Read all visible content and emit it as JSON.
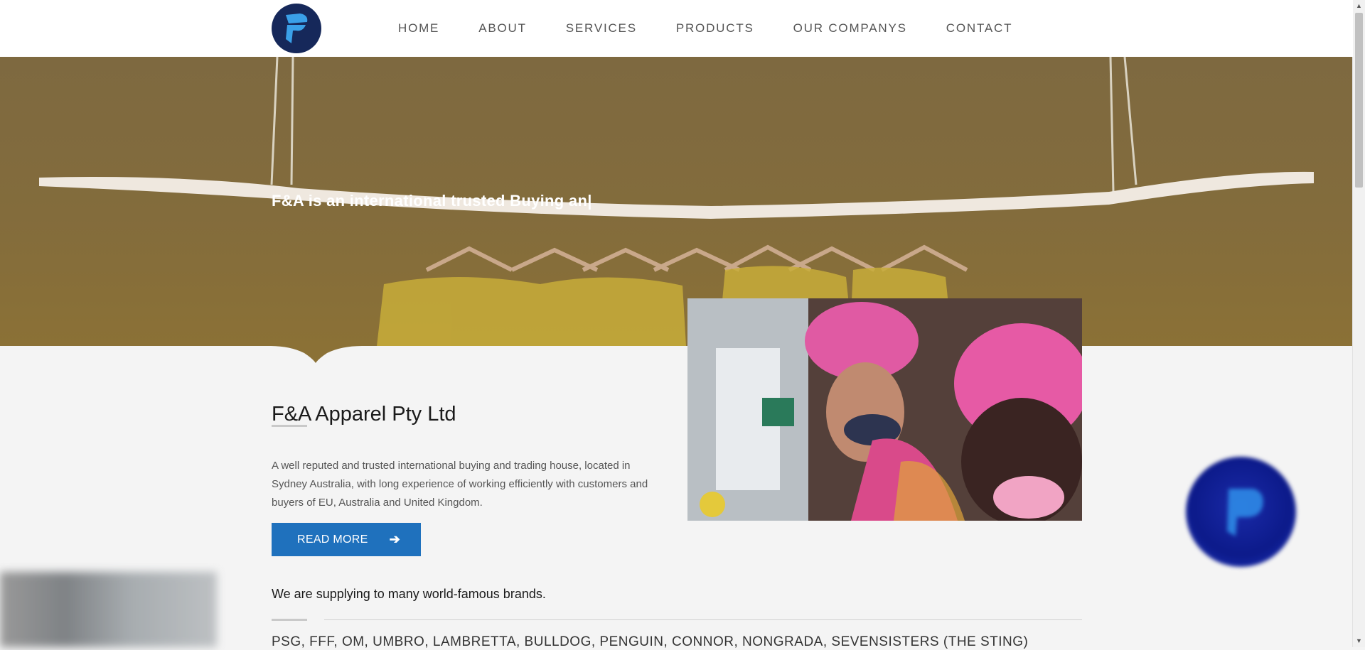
{
  "header": {
    "logo_icon": "fa-logo-icon",
    "nav": [
      {
        "label": "HOME"
      },
      {
        "label": "ABOUT"
      },
      {
        "label": "SERVICES"
      },
      {
        "label": "PRODUCTS"
      },
      {
        "label": "OUR COMPANYS"
      },
      {
        "label": "CONTACT"
      }
    ]
  },
  "hero": {
    "typing_text": "F&A is an international trusted Buying an|"
  },
  "about": {
    "title": "F&A Apparel Pty Ltd",
    "description": "A well reputed and trusted international buying and trading house, located in Sydney Australia, with long experience of working efficiently with customers and buyers of EU, Australia and United Kingdom.",
    "read_more_label": "READ MORE",
    "read_more_icon": "arrow-right-icon"
  },
  "brands": {
    "heading": "We are supplying to many world-famous brands.",
    "list": "PSG, FFF, OM, UMBRO, LAMBRETTA, BULLDOG, PENGUIN, CONNOR, NONGRADA, SEVENSISTERS (THE STING)"
  },
  "colors": {
    "accent": "#1f71bd",
    "logo_bg": "#16285a",
    "hero_overlay": "#7e6940"
  }
}
